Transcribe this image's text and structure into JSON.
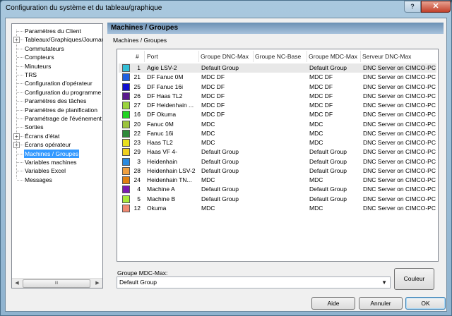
{
  "window": {
    "title": "Configuration du système et du tableau/graphique",
    "help_label": "?",
    "close_label": "✕"
  },
  "tree": {
    "items": [
      {
        "label": "Paramètres du Client",
        "level": 0,
        "expandable": false,
        "selected": false
      },
      {
        "label": "Tableaux/Graphiques/Journaux",
        "level": 0,
        "expandable": true,
        "selected": false
      },
      {
        "label": "Commutateurs",
        "level": 0,
        "expandable": false,
        "selected": false
      },
      {
        "label": "Compteurs",
        "level": 0,
        "expandable": false,
        "selected": false
      },
      {
        "label": "Minuteurs",
        "level": 0,
        "expandable": false,
        "selected": false
      },
      {
        "label": "TRS",
        "level": 0,
        "expandable": false,
        "selected": false
      },
      {
        "label": "Configuration d'opérateur",
        "level": 0,
        "expandable": false,
        "selected": false
      },
      {
        "label": "Configuration du programme",
        "level": 0,
        "expandable": false,
        "selected": false
      },
      {
        "label": "Paramètres des tâches",
        "level": 0,
        "expandable": false,
        "selected": false
      },
      {
        "label": "Paramètres de planification",
        "level": 0,
        "expandable": false,
        "selected": false
      },
      {
        "label": "Paramétrage de l'événement",
        "level": 0,
        "expandable": false,
        "selected": false
      },
      {
        "label": "Sorties",
        "level": 0,
        "expandable": false,
        "selected": false
      },
      {
        "label": "Écrans d'état",
        "level": 0,
        "expandable": true,
        "selected": false
      },
      {
        "label": "Écrans opérateur",
        "level": 0,
        "expandable": true,
        "selected": false
      },
      {
        "label": "Machines / Groupes",
        "level": 0,
        "expandable": false,
        "selected": true
      },
      {
        "label": "Variables machines",
        "level": 0,
        "expandable": false,
        "selected": false
      },
      {
        "label": "Variables Excel",
        "level": 0,
        "expandable": false,
        "selected": false
      },
      {
        "label": "Messages",
        "level": 0,
        "expandable": false,
        "selected": false
      }
    ],
    "scroll_left": "◀",
    "scroll_right": "▶",
    "scroll_grip": "III"
  },
  "panel": {
    "header": "Machines / Groupes",
    "subtitle": "Machines / Groupes"
  },
  "table": {
    "columns": [
      "#",
      "Port",
      "Groupe DNC-Max",
      "Groupe NC-Base",
      "Groupe MDC-Max",
      "Serveur DNC-Max"
    ],
    "rows": [
      {
        "color": "#33bfd6",
        "num": "1",
        "port": "Agie LSV-2",
        "dnc": "Default Group",
        "nc": "",
        "mdc": "Default Group",
        "server": "DNC Server on CIMCO-PC"
      },
      {
        "color": "#1f5fe0",
        "num": "21",
        "port": "DF Fanuc 0M",
        "dnc": "MDC DF",
        "nc": "",
        "mdc": "MDC DF",
        "server": "DNC Server on CIMCO-PC"
      },
      {
        "color": "#1010d0",
        "num": "25",
        "port": "DF Fanuc 16i",
        "dnc": "MDC DF",
        "nc": "",
        "mdc": "MDC DF",
        "server": "DNC Server on CIMCO-PC"
      },
      {
        "color": "#5a1a8c",
        "num": "26",
        "port": "DF Haas TL2",
        "dnc": "MDC DF",
        "nc": "",
        "mdc": "MDC DF",
        "server": "DNC Server on CIMCO-PC"
      },
      {
        "color": "#9ad43c",
        "num": "27",
        "port": "DF Heidenhain ...",
        "dnc": "MDC DF",
        "nc": "",
        "mdc": "MDC DF",
        "server": "DNC Server on CIMCO-PC"
      },
      {
        "color": "#22d422",
        "num": "16",
        "port": "DF Okuma",
        "dnc": "MDC DF",
        "nc": "",
        "mdc": "MDC DF",
        "server": "DNC Server on CIMCO-PC"
      },
      {
        "color": "#9bc43c",
        "num": "20",
        "port": "Fanuc 0M",
        "dnc": "MDC",
        "nc": "",
        "mdc": "MDC",
        "server": "DNC Server on CIMCO-PC"
      },
      {
        "color": "#2f8a3a",
        "num": "22",
        "port": "Fanuc 16i",
        "dnc": "MDC",
        "nc": "",
        "mdc": "MDC",
        "server": "DNC Server on CIMCO-PC"
      },
      {
        "color": "#e8e020",
        "num": "23",
        "port": "Haas TL2",
        "dnc": "MDC",
        "nc": "",
        "mdc": "MDC",
        "server": "DNC Server on CIMCO-PC"
      },
      {
        "color": "#f0d020",
        "num": "29",
        "port": "Haas VF 4-",
        "dnc": "Default Group",
        "nc": "",
        "mdc": "Default Group",
        "server": "DNC Server on CIMCO-PC"
      },
      {
        "color": "#2a8ae0",
        "num": "3",
        "port": "Heidenhain",
        "dnc": "Default Group",
        "nc": "",
        "mdc": "Default Group",
        "server": "DNC Server on CIMCO-PC"
      },
      {
        "color": "#f0a040",
        "num": "28",
        "port": "Heidenhain LSV-2",
        "dnc": "Default Group",
        "nc": "",
        "mdc": "Default Group",
        "server": "DNC Server on CIMCO-PC"
      },
      {
        "color": "#e08010",
        "num": "24",
        "port": "Heidenhain TN...",
        "dnc": "MDC",
        "nc": "",
        "mdc": "MDC",
        "server": "DNC Server on CIMCO-PC"
      },
      {
        "color": "#7a1ab0",
        "num": "4",
        "port": "Machine A",
        "dnc": "Default Group",
        "nc": "",
        "mdc": "Default Group",
        "server": "DNC Server on CIMCO-PC"
      },
      {
        "color": "#a8e838",
        "num": "5",
        "port": "Machine B",
        "dnc": "Default Group",
        "nc": "",
        "mdc": "Default Group",
        "server": "DNC Server on CIMCO-PC"
      },
      {
        "color": "#f08870",
        "num": "12",
        "port": "Okuma",
        "dnc": "MDC",
        "nc": "",
        "mdc": "MDC",
        "server": "DNC Server on CIMCO-PC"
      }
    ]
  },
  "mdc_group": {
    "label": "Groupe MDC-Max:",
    "value": "Default Group",
    "arrow": "▼"
  },
  "buttons": {
    "color": "Couleur",
    "help": "Aide",
    "cancel": "Annuler",
    "ok": "OK"
  }
}
